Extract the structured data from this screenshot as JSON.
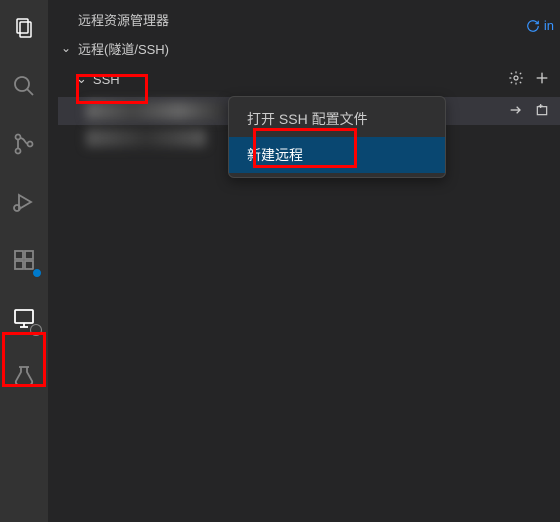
{
  "panel": {
    "title": "远程资源管理器"
  },
  "tree": {
    "root_label": "远程(隧道/SSH)",
    "ssh_label": "SSH",
    "actions": {
      "settings_title": "配置",
      "add_title": "新建"
    }
  },
  "host": {
    "actions": {
      "arrow_title": "在当前窗口连接",
      "newwin_title": "在新窗口中连接"
    }
  },
  "context_menu": {
    "open_config": "打开 SSH 配置文件",
    "new_remote": "新建远程"
  },
  "activity": {
    "explorer": "资源管理器",
    "search": "搜索",
    "scm": "源代码管理",
    "debug": "运行和调试",
    "extensions": "扩展",
    "remote": "远程资源管理器",
    "testing": "测试"
  },
  "topright": {
    "label": "in"
  },
  "colors": {
    "highlight": "#ff0000",
    "accent": "#007acc"
  }
}
